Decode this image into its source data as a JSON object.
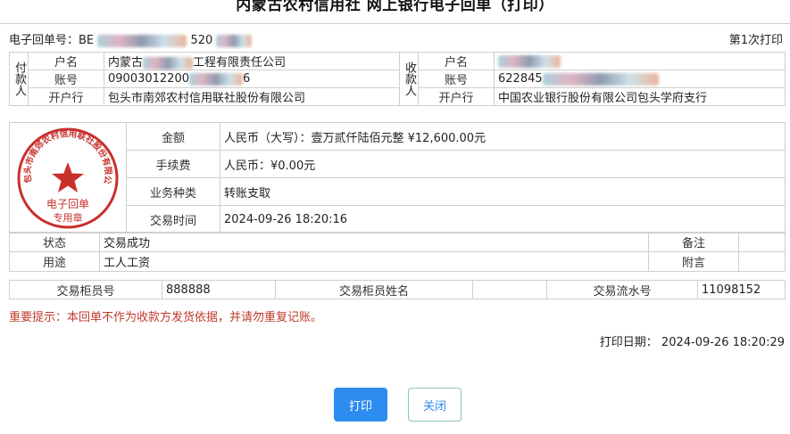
{
  "header": {
    "title": "内蒙古农村信用社 网上银行电子回单（打印）",
    "receipt_no_label": "电子回单号：",
    "receipt_no_prefix": "BE",
    "receipt_no_suffix": "520",
    "print_count": "第1次打印"
  },
  "payer": {
    "side_label": "付款人",
    "name_label": "户名",
    "name_prefix": "内蒙古",
    "name_suffix": "工程有限责任公司",
    "account_label": "账号",
    "account_prefix": "09003012200",
    "account_suffix": "6",
    "bank_label": "开户行",
    "bank": "包头市南郊农村信用联社股份有限公司"
  },
  "payee": {
    "side_label": "收款人",
    "name_label": "户名",
    "account_label": "账号",
    "account_prefix": "622845",
    "bank_label": "开户行",
    "bank": "中国农业银行股份有限公司包头学府支行"
  },
  "seal": {
    "ring_text": "包头市南郊农村信用联社股份有限公司",
    "line1": "电子回单",
    "line2": "专用章",
    "color": "#c8302c"
  },
  "transaction": {
    "amount_label": "金额",
    "amount": "人民币（大写）：壹万贰仟陆佰元整  ¥12,600.00元",
    "fee_label": "手续费",
    "fee": "人民币：¥0.00元",
    "type_label": "业务种类",
    "type": "转账支取",
    "time_label": "交易时间",
    "time": "2024-09-26 18:20:16"
  },
  "status_block": {
    "status_label": "状态",
    "status": "交易成功",
    "remark_label": "备注",
    "remark": "",
    "purpose_label": "用途",
    "purpose": "工人工资",
    "postscript_label": "附言",
    "postscript": ""
  },
  "teller": {
    "teller_no_label": "交易柜员号",
    "teller_no": "888888",
    "teller_name_label": "交易柜员姓名",
    "teller_name": "",
    "serial_label": "交易流水号",
    "serial": "11098152"
  },
  "notice": "重要提示：本回单不作为收款方发货依据，并请勿重复记账。",
  "print_date_label": "打印日期：",
  "print_date": "2024-09-26 18:20:29",
  "buttons": {
    "print": "打印",
    "close": "关闭"
  }
}
